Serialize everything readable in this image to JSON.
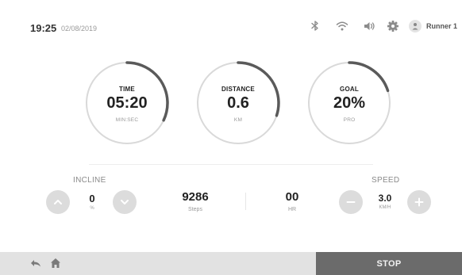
{
  "status_bar": {
    "time": "19:25",
    "date": "02/08/2019",
    "icons": [
      "bluetooth-icon",
      "wifi-icon",
      "volume-icon",
      "gear-icon",
      "user-icon"
    ],
    "user_name": "Runner 1"
  },
  "metrics": {
    "time": {
      "title": "TIME",
      "value": "05:20",
      "unit": "MIN:SEC",
      "progress": 0.32
    },
    "distance": {
      "title": "DISTANCE",
      "value": "0.6",
      "unit": "KM",
      "progress": 0.3
    },
    "goal": {
      "title": "GOAL",
      "value": "20%",
      "unit": "PRO",
      "progress": 0.2
    }
  },
  "incline": {
    "label": "INCLINE",
    "value": "0",
    "unit": "%"
  },
  "steps": {
    "value": "9286",
    "label": "Steps"
  },
  "heart_rate": {
    "value": "00",
    "label": "HR"
  },
  "speed": {
    "label": "SPEED",
    "value": "3.0",
    "unit": "KM/H"
  },
  "bottom_bar": {
    "stop_label": "STOP"
  },
  "colors": {
    "arc_progress": "#5a5a5a",
    "arc_track": "#d9d9d9",
    "stop_bg": "#6b6b6b",
    "bar_bg": "#e2e2e2",
    "button_bg": "#dcdcdc"
  }
}
